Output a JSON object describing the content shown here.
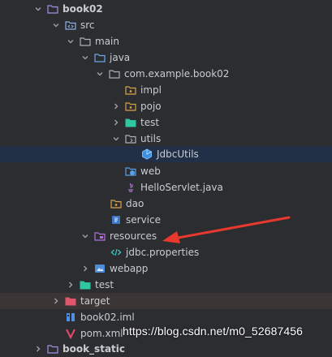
{
  "tree": {
    "nodes": [
      {
        "label": "book02",
        "expanded": true
      },
      {
        "label": "src",
        "expanded": true
      },
      {
        "label": "main",
        "expanded": true
      },
      {
        "label": "java",
        "expanded": true
      },
      {
        "label": "com.example.book02",
        "expanded": true
      },
      {
        "label": "impl"
      },
      {
        "label": "pojo",
        "expanded": false
      },
      {
        "label": "test",
        "expanded": false
      },
      {
        "label": "utils",
        "expanded": true
      },
      {
        "label": "JdbcUtils",
        "selected": true
      },
      {
        "label": "web"
      },
      {
        "label": "HelloServlet.java"
      },
      {
        "label": "dao"
      },
      {
        "label": "service"
      },
      {
        "label": "resources",
        "expanded": true
      },
      {
        "label": "jdbc.properties"
      },
      {
        "label": "webapp",
        "expanded": false
      },
      {
        "label": "test",
        "expanded": false
      },
      {
        "label": "target",
        "expanded": false
      },
      {
        "label": "book02.iml"
      },
      {
        "label": "pom.xml"
      },
      {
        "label": "book_static"
      }
    ]
  },
  "watermark": {
    "text": "https://blog.csdn.net/m0_52687456"
  },
  "colors": {
    "background": "#2b2d30",
    "selection": "#213046",
    "excluded": "#3b3536",
    "arrow": "#e8392e"
  }
}
